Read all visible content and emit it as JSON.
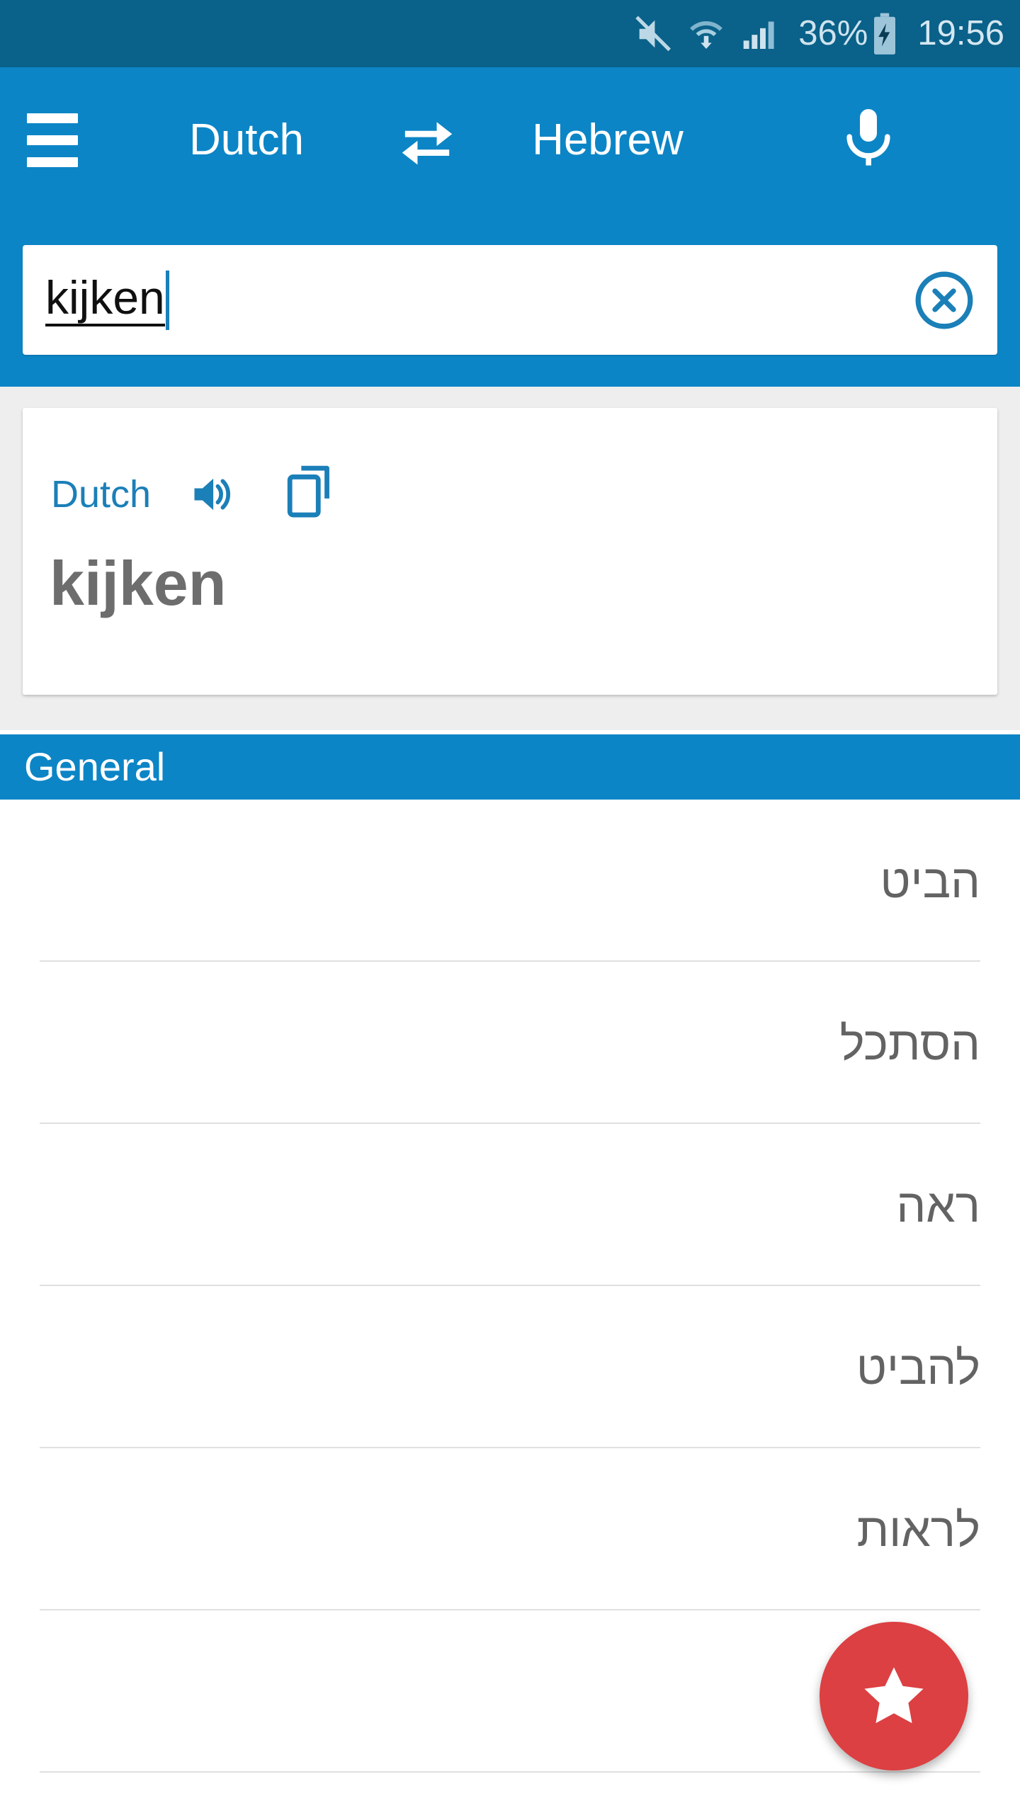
{
  "status_bar": {
    "icons": [
      "mute-icon",
      "wifi-data-icon",
      "signal-icon",
      "battery-charging-icon"
    ],
    "battery_percent": "36%",
    "clock": "19:56"
  },
  "app_bar": {
    "menu_icon": "hamburger-menu-icon",
    "source_language": "Dutch",
    "swap_icon": "swap-arrows-icon",
    "target_language": "Hebrew",
    "mic_icon": "microphone-icon"
  },
  "search": {
    "value": "kijken",
    "placeholder": "",
    "clear_icon": "clear-circle-icon"
  },
  "card": {
    "language_label": "Dutch",
    "speaker_icon": "speaker-icon",
    "copy_icon": "copy-icon",
    "word": "kijken"
  },
  "section": {
    "title": "General"
  },
  "translations": [
    {
      "text": "הביט"
    },
    {
      "text": "הסתכל"
    },
    {
      "text": "ראה"
    },
    {
      "text": "להביט"
    },
    {
      "text": "לראות"
    },
    {
      "text": ""
    }
  ],
  "fab": {
    "icon": "star-icon"
  },
  "colors": {
    "status_bar": "#0a6189",
    "app_bar": "#0c85c6",
    "accent": "#1b7fb8",
    "fab": "#dc4042",
    "card_bg": "#ffffff",
    "page_bg": "#eeeeee",
    "word_text": "#6d6d6d",
    "list_text": "#636363"
  }
}
